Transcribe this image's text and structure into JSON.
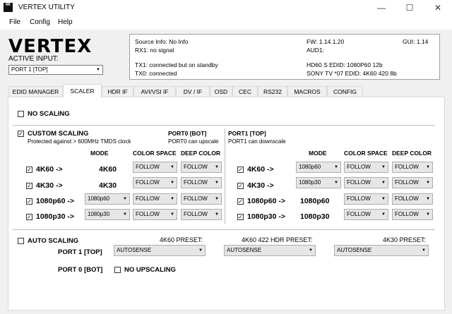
{
  "window": {
    "icon_text": "4K",
    "title": "VERTEX UTILITY",
    "minimize": "—",
    "maximize": "☐",
    "close": "✕"
  },
  "menu": [
    "File",
    "Config",
    "Help"
  ],
  "logo": "VERTEX",
  "active_input": {
    "label": "ACTIVE INPUT:",
    "value": "PORT 1 [TOP]"
  },
  "info": {
    "source": "Source Info: No Info",
    "rx1": "RX1: no signal",
    "tx1": "TX1: connected but on standby",
    "tx0": "TX0: connected",
    "fw": "FW: 1.14.1.20",
    "gui": "GUI: 1.14",
    "aud1": "AUD1:",
    "hd60": "HD60 S EDID: 1080P60 12b",
    "sony": "SONY TV  *07 EDID: 4K60 420 8b"
  },
  "tabs": [
    "EDID MANAGER",
    "SCALER",
    "HDR IF",
    "AVI/VSI IF",
    "DV / IF",
    "OSD",
    "CEC",
    "RS232",
    "MACROS",
    "CONFIG"
  ],
  "active_tab": "SCALER",
  "no_scaling": {
    "label": "NO SCALING",
    "checked": false
  },
  "custom_scaling": {
    "label": "CUSTOM SCALING",
    "checked": true,
    "note": "Protected against > 600MHz TMDS clock"
  },
  "port0": {
    "title": "PORT0 [BOT]",
    "note": "PORT0 can upscale"
  },
  "port1": {
    "title": "PORT1 [TOP]",
    "note": "PORT1 can downscale"
  },
  "headers": {
    "mode": "MODE",
    "color_space": "COLOR SPACE",
    "deep_color": "DEEP COLOR"
  },
  "port0_rows": [
    {
      "label": "4K60 ->",
      "mode": "4K60",
      "mode_is_select": false,
      "color": "FOLLOW",
      "deep": "FOLLOW"
    },
    {
      "label": "4K30 ->",
      "mode": "4K30",
      "mode_is_select": false,
      "color": "FOLLOW",
      "deep": "FOLLOW"
    },
    {
      "label": "1080p60 ->",
      "mode": "1080p60",
      "mode_is_select": true,
      "color": "FOLLOW",
      "deep": "FOLLOW"
    },
    {
      "label": "1080p30 ->",
      "mode": "1080p30",
      "mode_is_select": true,
      "color": "FOLLOW",
      "deep": "FOLLOW"
    }
  ],
  "port1_rows": [
    {
      "label": "4K60 ->",
      "mode": "1080p60",
      "mode_is_select": true,
      "color": "FOLLOW",
      "deep": "FOLLOW"
    },
    {
      "label": "4K30 ->",
      "mode": "1080p30",
      "mode_is_select": true,
      "color": "FOLLOW",
      "deep": "FOLLOW"
    },
    {
      "label": "1080p60 ->",
      "mode": "1080p60",
      "mode_is_select": false,
      "color": "FOLLOW",
      "deep": "FOLLOW"
    },
    {
      "label": "1080p30 ->",
      "mode": "1080p30",
      "mode_is_select": false,
      "color": "FOLLOW",
      "deep": "FOLLOW"
    }
  ],
  "auto_scaling": {
    "label": "AUTO SCALING",
    "checked": false,
    "preset_4k60": "4K60 PRESET:",
    "preset_4k60_hdr": "4K60 422 HDR PRESET:",
    "preset_4k30": "4K30 PRESET:",
    "port1_label": "PORT 1 [TOP]",
    "port0_label": "PORT 0 [BOT]",
    "sel1": "AUTOSENSE",
    "sel2": "AUTOSENSE",
    "sel3": "AUTOSENSE",
    "no_upscaling": "NO UPSCALING"
  }
}
